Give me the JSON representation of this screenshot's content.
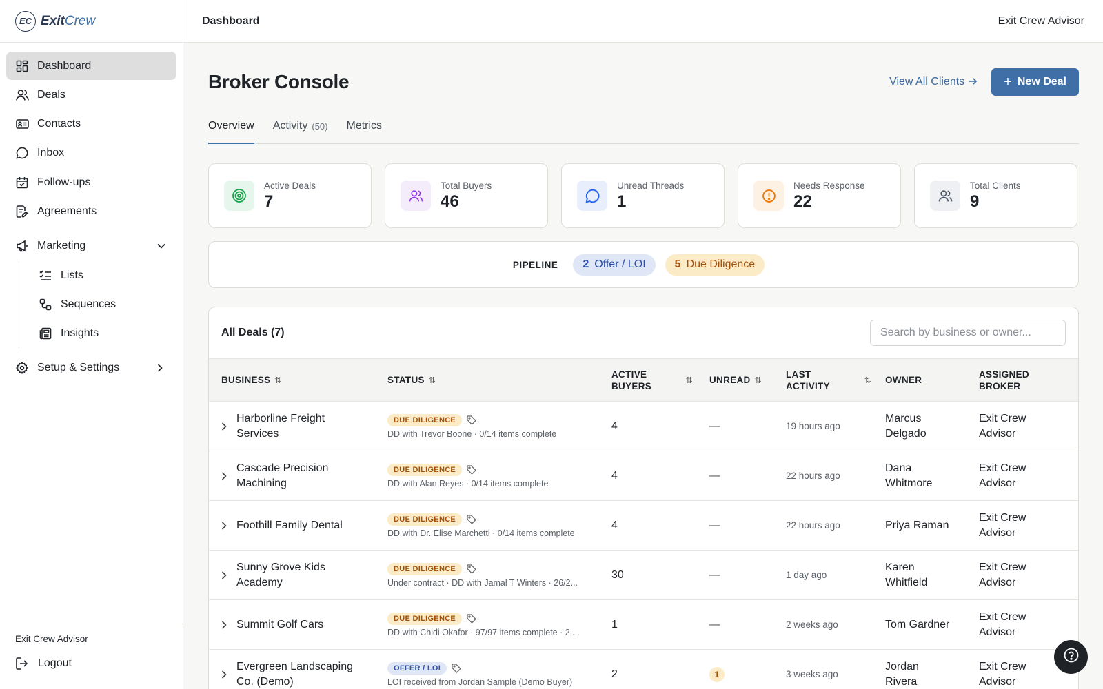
{
  "brand": {
    "mark": "EC",
    "name_bold": "Exit",
    "name_light": "Crew"
  },
  "sidebar": {
    "items": [
      {
        "label": "Dashboard",
        "icon": "dashboard-icon"
      },
      {
        "label": "Deals",
        "icon": "users-icon"
      },
      {
        "label": "Contacts",
        "icon": "id-card-icon"
      },
      {
        "label": "Inbox",
        "icon": "chat-icon"
      },
      {
        "label": "Follow-ups",
        "icon": "calendar-icon"
      },
      {
        "label": "Agreements",
        "icon": "document-sign-icon"
      }
    ],
    "marketing": {
      "label": "Marketing",
      "icon": "megaphone-icon"
    },
    "marketing_items": [
      {
        "label": "Lists",
        "icon": "list-check-icon"
      },
      {
        "label": "Sequences",
        "icon": "sequence-icon"
      },
      {
        "label": "Insights",
        "icon": "newspaper-icon"
      }
    ],
    "settings": {
      "label": "Setup & Settings",
      "icon": "gear-icon"
    },
    "footer_user": "Exit Crew Advisor",
    "logout": "Logout"
  },
  "topbar": {
    "title": "Dashboard",
    "user": "Exit Crew Advisor"
  },
  "page": {
    "title": "Broker Console",
    "view_all": "View All Clients",
    "new_deal": "New Deal"
  },
  "tabs": [
    {
      "label": "Overview",
      "count": ""
    },
    {
      "label": "Activity",
      "count": "(50)"
    },
    {
      "label": "Metrics",
      "count": ""
    }
  ],
  "stats": [
    {
      "label": "Active Deals",
      "value": "7",
      "icon": "target-icon",
      "color": "#16a34a",
      "bg": "#e7f6ec"
    },
    {
      "label": "Total Buyers",
      "value": "46",
      "icon": "users-icon",
      "color": "#9333ea",
      "bg": "#f4ecfb"
    },
    {
      "label": "Unread Threads",
      "value": "1",
      "icon": "chat-icon",
      "color": "#2563eb",
      "bg": "#e8eefb"
    },
    {
      "label": "Needs Response",
      "value": "22",
      "icon": "alert-icon",
      "color": "#ea7a0c",
      "bg": "#fdf1e3"
    },
    {
      "label": "Total Clients",
      "value": "9",
      "icon": "users-icon",
      "color": "#4b5563",
      "bg": "#eef0f3"
    }
  ],
  "pipeline": {
    "label": "PIPELINE",
    "stages": [
      {
        "count": "2",
        "label": "Offer / LOI"
      },
      {
        "count": "5",
        "label": "Due Diligence"
      }
    ]
  },
  "deals": {
    "title": "All Deals (7)",
    "search_placeholder": "Search by business or owner...",
    "columns": {
      "business": "BUSINESS",
      "status": "STATUS",
      "active_buyers_1": "ACTIVE",
      "active_buyers_2": "BUYERS",
      "unread": "UNREAD",
      "last_activity_1": "LAST",
      "last_activity_2": "ACTIVITY",
      "owner": "OWNER",
      "broker_1": "ASSIGNED",
      "broker_2": "BROKER"
    },
    "rows": [
      {
        "name1": "Harborline Freight",
        "name2": "Services",
        "status": "DUE DILIGENCE",
        "desc": "DD with Trevor Boone · 0/14 items complete",
        "buyers": "4",
        "unread": "—",
        "activity": "19 hours ago",
        "owner1": "Marcus",
        "owner2": "Delgado",
        "broker1": "Exit Crew",
        "broker2": "Advisor"
      },
      {
        "name1": "Cascade Precision",
        "name2": "Machining",
        "status": "DUE DILIGENCE",
        "desc": "DD with Alan Reyes · 0/14 items complete",
        "buyers": "4",
        "unread": "—",
        "activity": "22 hours ago",
        "owner1": "Dana",
        "owner2": "Whitmore",
        "broker1": "Exit Crew",
        "broker2": "Advisor"
      },
      {
        "name1": "Foothill Family Dental",
        "name2": "",
        "status": "DUE DILIGENCE",
        "desc": "DD with Dr. Elise Marchetti · 0/14 items complete",
        "buyers": "4",
        "unread": "—",
        "activity": "22 hours ago",
        "owner1": "Priya Raman",
        "owner2": "",
        "broker1": "Exit Crew",
        "broker2": "Advisor"
      },
      {
        "name1": "Sunny Grove Kids",
        "name2": "Academy",
        "status": "DUE DILIGENCE",
        "desc": "Under contract · DD with Jamal T Winters · 26/2...",
        "buyers": "30",
        "unread": "—",
        "activity": "1 day ago",
        "owner1": "Karen",
        "owner2": "Whitfield",
        "broker1": "Exit Crew",
        "broker2": "Advisor"
      },
      {
        "name1": "Summit Golf Cars",
        "name2": "",
        "status": "DUE DILIGENCE",
        "desc": "DD with Chidi Okafor · 97/97 items complete · 2 ...",
        "buyers": "1",
        "unread": "—",
        "activity": "2 weeks ago",
        "owner1": "Tom Gardner",
        "owner2": "",
        "broker1": "Exit Crew",
        "broker2": "Advisor"
      },
      {
        "name1": "Evergreen Landscaping",
        "name2": "Co. (Demo)",
        "status": "OFFER / LOI",
        "desc": "LOI received from Jordan Sample (Demo Buyer)",
        "buyers": "2",
        "unread": "1",
        "activity": "3 weeks ago",
        "owner1": "Jordan",
        "owner2": "Rivera",
        "broker1": "Exit Crew",
        "broker2": "Advisor"
      }
    ]
  }
}
